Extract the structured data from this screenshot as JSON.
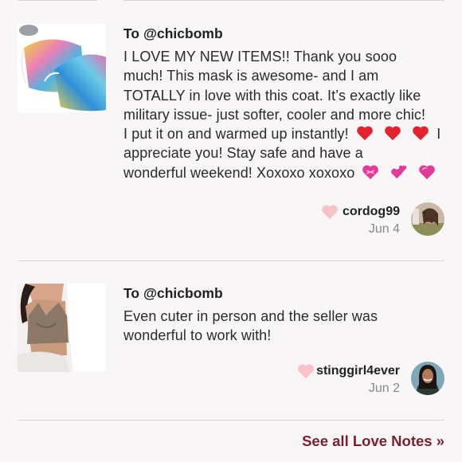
{
  "notes": [
    {
      "to": "To @chicbomb",
      "message_lines": [
        "I LOVE MY NEW ITEMS!! Thank you sooo",
        "much! This mask is awesome- and I am",
        "TOTALLY in love with this coat. It’s exactly like",
        "military issue- just softer, cooler and more chic!",
        "I put it on and warmed up instantly!",
        "I",
        "appreciate you! Stay safe and have a",
        "wonderful weekend! Xoxoxo xoxoxo"
      ],
      "username": "cordog99",
      "date": "Jun 4",
      "thumbnail_icon": "tie-dye-mask-photo",
      "avatar_icon": "user-avatar-photo"
    },
    {
      "to": "To @chicbomb",
      "message_lines": [
        "Even cuter in person and the seller was",
        "wonderful to work with!"
      ],
      "username": "stinggirl4ever",
      "date": "Jun 2",
      "thumbnail_icon": "crop-top-photo",
      "avatar_icon": "user-avatar-photo"
    }
  ],
  "see_all_label": "See all Love Notes »",
  "colors": {
    "accent": "#7a2030",
    "heart_red": "#e0232e",
    "heart_pink": "#e23a9b",
    "like_heart": "#f6c3c6",
    "divider": "#d9d6d6",
    "background": "#f8f6f6"
  }
}
